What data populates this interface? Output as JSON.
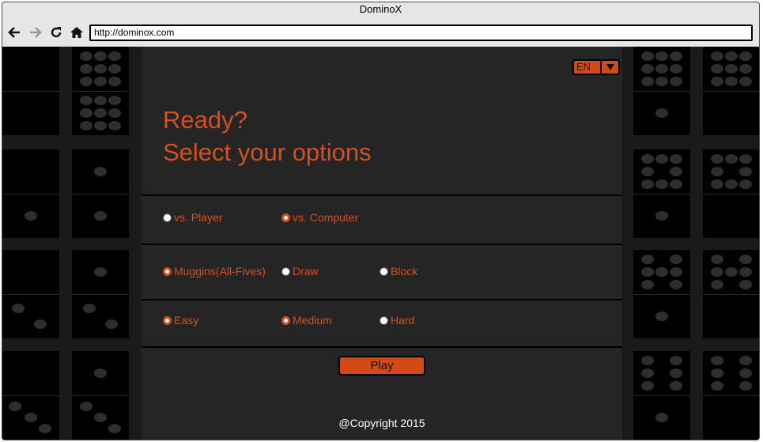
{
  "window": {
    "title": "DominoX"
  },
  "nav": {
    "back_icon": "arrow-left-icon",
    "forward_icon": "arrow-right-icon",
    "reload_icon": "reload-icon",
    "home_icon": "home-icon",
    "url": "http://dominox.com"
  },
  "language": {
    "selected": "EN"
  },
  "heading": {
    "line1": "Ready?",
    "line2": "Select your options"
  },
  "options": {
    "opponent": [
      {
        "label": "vs. Player",
        "selected": false
      },
      {
        "label": "vs. Computer",
        "selected": true
      }
    ],
    "variant": [
      {
        "label": "Muggins(All-Fives)",
        "selected": true
      },
      {
        "label": "Draw",
        "selected": false
      },
      {
        "label": "Block",
        "selected": false
      }
    ],
    "difficulty": [
      {
        "label": "Easy",
        "selected": true
      },
      {
        "label": "Medium",
        "selected": true
      },
      {
        "label": "Hard",
        "selected": false
      }
    ]
  },
  "play_label": "Play",
  "footer": {
    "copyright": "@Copyright 2015"
  },
  "colors": {
    "accent": "#d44a17",
    "text_accent": "#d4501f",
    "panel": "#252525",
    "background": "#000000"
  }
}
